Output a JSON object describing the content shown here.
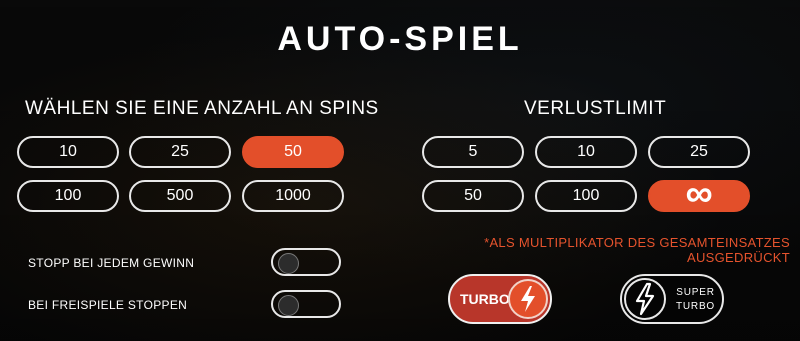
{
  "title": "AUTO-SPIEL",
  "spins": {
    "label": "WÄHLEN SIE EINE ANZAHL AN SPINS",
    "options": [
      "10",
      "25",
      "50",
      "100",
      "500",
      "1000"
    ],
    "selected": "50"
  },
  "loss_limit": {
    "label": "VERLUSTLIMIT",
    "options": [
      "5",
      "10",
      "25",
      "50",
      "100",
      "∞"
    ],
    "selected": "∞",
    "note": "*ALS MULTIPLIKATOR DES GESAMTEINSATZES AUSGEDRÜCKT"
  },
  "toggles": [
    {
      "label": "STOPP BEI JEDEM GEWINN",
      "on": false
    },
    {
      "label": "BEI FREISPIELE STOPPEN",
      "on": false
    }
  ],
  "turbo": {
    "label": "TURBO",
    "active": true
  },
  "super_turbo": {
    "line1": "SUPER",
    "line2": "TURBO",
    "active": false
  },
  "colors": {
    "accent": "#e34f2a",
    "note": "#e5532d",
    "background": "#131313"
  },
  "icons": {
    "turbo": "lightning-bolt-icon",
    "super_turbo": "lightning-bolt-icon"
  }
}
